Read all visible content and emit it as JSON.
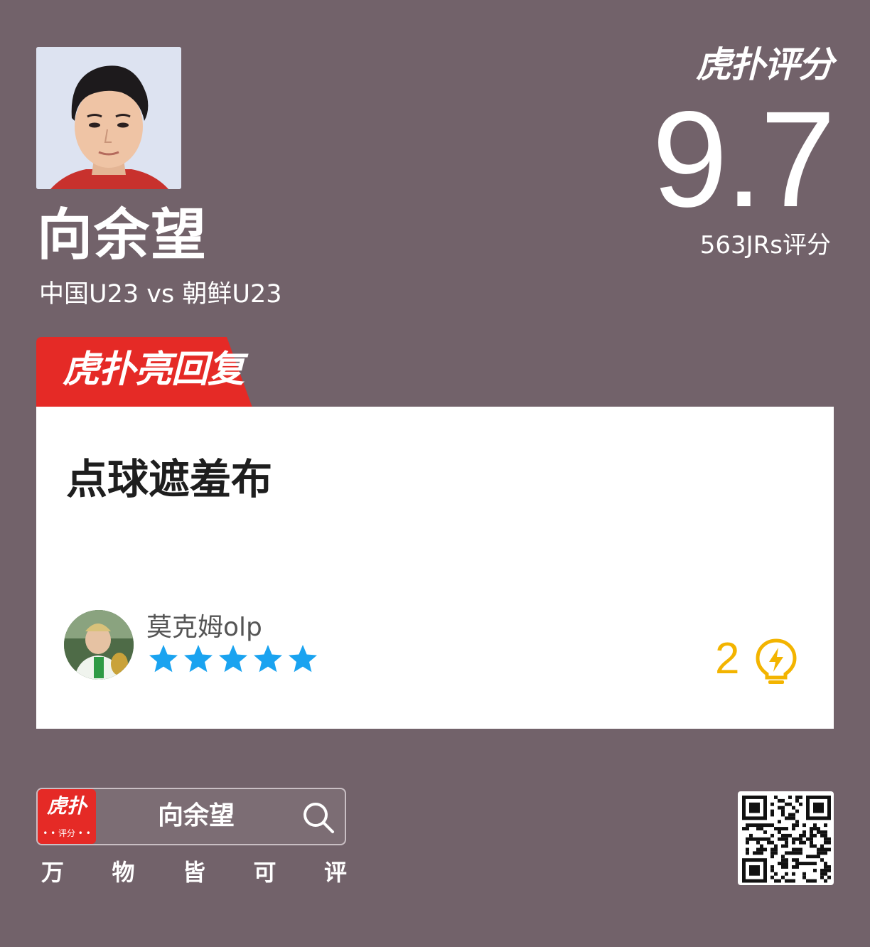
{
  "player": {
    "name": "向余望",
    "match": "中国U23 vs 朝鲜U23"
  },
  "header": {
    "brand": "虎扑评分",
    "score": "9.7",
    "rating_count": "563JRs评分"
  },
  "section_tag": "虎扑亮回复",
  "comment": {
    "text": "点球遮羞布",
    "author": "莫克姆olp",
    "stars": 5,
    "likes": "2",
    "star_color": "#1aa3f0",
    "like_color": "#f3b400"
  },
  "footer": {
    "app_icon_top": "虎扑",
    "app_icon_bottom": "• • 评分 • •",
    "search_text": "向余望",
    "slogan": [
      "万",
      "物",
      "皆",
      "可",
      "评"
    ]
  },
  "colors": {
    "background": "#72626a",
    "accent_red": "#e52a26",
    "card": "#ffffff"
  }
}
